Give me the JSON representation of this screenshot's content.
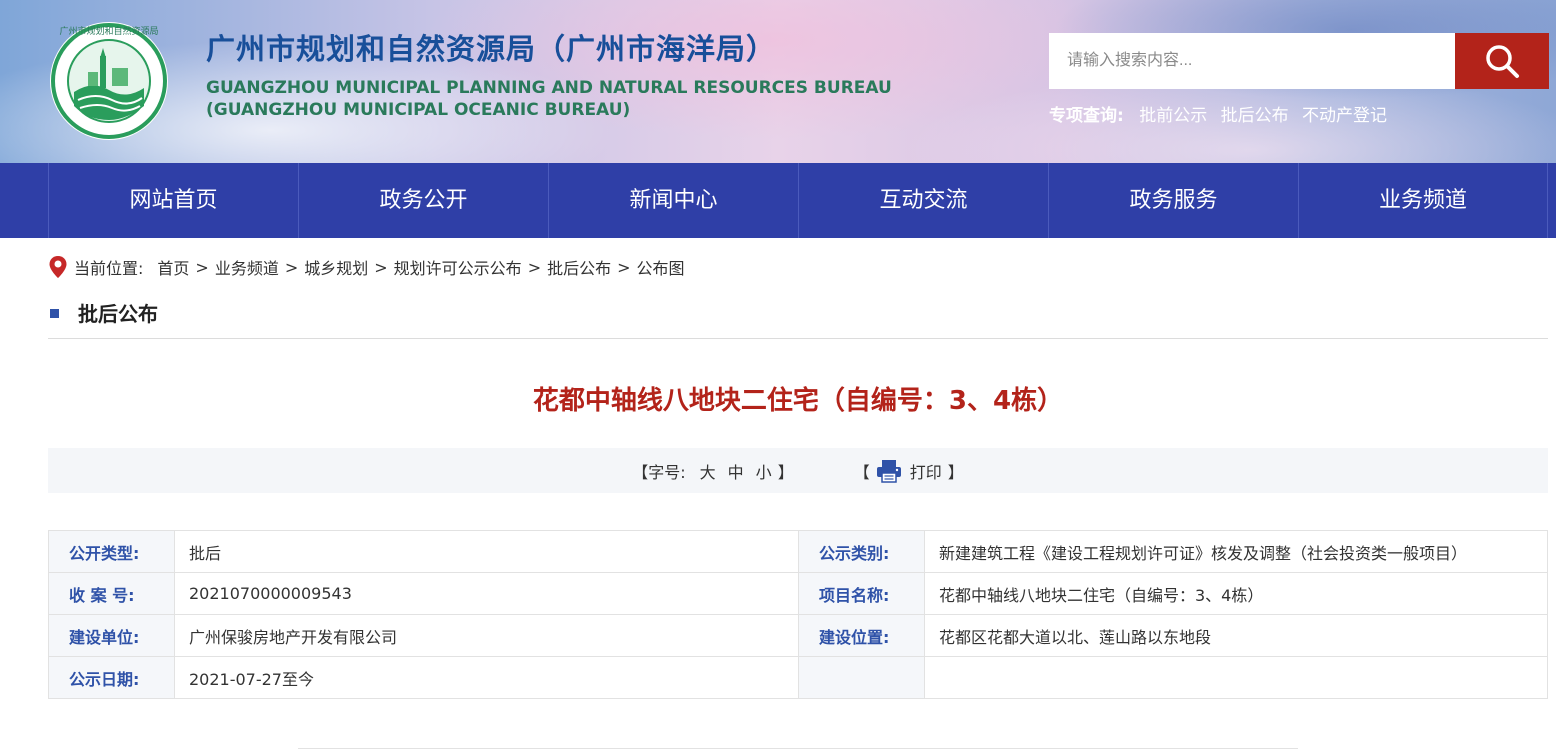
{
  "header": {
    "title_cn": "广州市规划和自然资源局（广州市海洋局）",
    "title_en_line1": "GUANGZHOU MUNICIPAL PLANNING AND NATURAL RESOURCES BUREAU",
    "title_en_line2": "(GUANGZHOU MUNICIPAL OCEANIC BUREAU)",
    "logo_text": "广州市规划和自然资源局",
    "search_placeholder": "请输入搜索内容...",
    "special_label": "专项查询:",
    "special_links": [
      "批前公示",
      "批后公布",
      "不动产登记"
    ]
  },
  "nav": {
    "items": [
      "网站首页",
      "政务公开",
      "新闻中心",
      "互动交流",
      "政务服务",
      "业务频道"
    ]
  },
  "breadcrumb": {
    "label": "当前位置:",
    "items": [
      "首页",
      "业务频道",
      "城乡规划",
      "规划许可公示公布",
      "批后公布",
      "公布图"
    ],
    "separator": ">"
  },
  "section": {
    "title": "批后公布"
  },
  "article": {
    "title": "花都中轴线八地块二住宅（自编号：3、4栋）",
    "font_label": "【字号:",
    "font_sizes": [
      "大",
      "中",
      "小"
    ],
    "font_close": "】",
    "print_open": "【",
    "print_label": "打印",
    "print_close": "】"
  },
  "info": {
    "rows": [
      {
        "k1": "公开类型:",
        "v1": "批后",
        "k2": "公示类别:",
        "v2": "新建建筑工程《建设工程规划许可证》核发及调整（社会投资类一般项目）"
      },
      {
        "k1": "收 案 号:",
        "v1": "2021070000009543",
        "k2": "项目名称:",
        "v2": "花都中轴线八地块二住宅（自编号：3、4栋）"
      },
      {
        "k1": "建设单位:",
        "v1": "广州保骏房地产开发有限公司",
        "k2": "建设位置:",
        "v2": "花都区花都大道以北、莲山路以东地段"
      },
      {
        "k1": "公示日期:",
        "v1": "2021-07-27至今",
        "k2": "",
        "v2": ""
      }
    ]
  },
  "colors": {
    "nav_bg": "#2f3fa7",
    "accent_red": "#b3231a",
    "title_blue": "#184f9a",
    "label_blue": "#2f52a8",
    "en_green": "#2a7a5b"
  },
  "icons": [
    "location-pin-icon",
    "search-icon",
    "printer-icon",
    "logo-emblem-icon"
  ]
}
